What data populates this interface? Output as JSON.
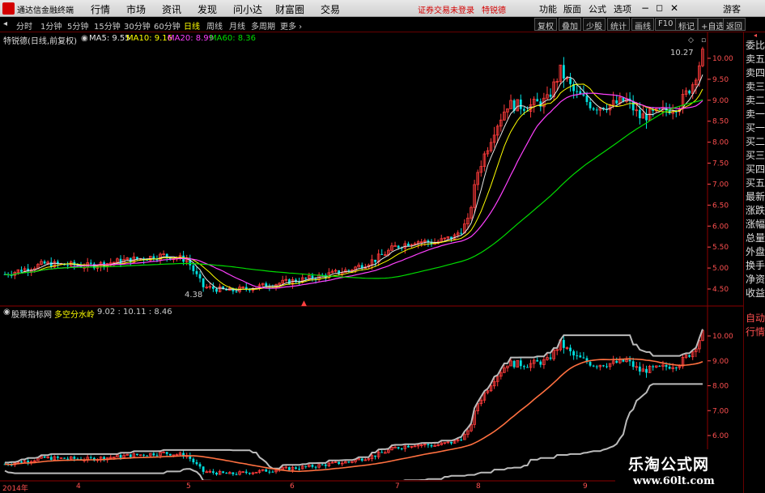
{
  "menubar": {
    "app_name": "通达信金融终端",
    "items": [
      "行情",
      "市场",
      "资讯",
      "发现",
      "问小达",
      "财富圈",
      "交易"
    ],
    "warning": "证券交易未登录",
    "user": "特锐德",
    "right_items": [
      "功能",
      "版面",
      "公式",
      "选项"
    ],
    "help": "游客"
  },
  "tabbar": {
    "periods": [
      "分时",
      "1分钟",
      "5分钟",
      "15分钟",
      "30分钟",
      "60分钟",
      "日线",
      "周线",
      "月线",
      "多周期",
      "更多 ›"
    ],
    "active_index": 6,
    "right_buttons": [
      "复权",
      "叠加",
      "少股",
      "统计",
      "画线",
      "F10",
      "标记",
      "+自选",
      "返回"
    ]
  },
  "main_info": {
    "stock": "特锐德(日线,前复权)",
    "ma5": "MA5: 9.55",
    "ma10": "MA10: 9.16",
    "ma20": "MA20: 8.99",
    "ma60": "MA60: 8.36"
  },
  "sub_info": {
    "site": "股票指标网",
    "indicator": "多空分水岭",
    "values": "9.02 : 10.11 : 8.46"
  },
  "right_panel": {
    "items": [
      "委比",
      "卖五",
      "卖四",
      "卖三",
      "卖二",
      "卖一",
      "买一",
      "买二",
      "买三",
      "买四",
      "买五",
      "最新",
      "涨跌",
      "涨幅",
      "总量",
      "外盘",
      "换手",
      "净资",
      "收益"
    ],
    "bottom_items": [
      "自动",
      "行情"
    ]
  },
  "main_axis": [
    "10.00",
    "9.50",
    "9.00",
    "8.50",
    "8.00",
    "7.50",
    "7.00",
    "6.50",
    "6.00",
    "5.50",
    "5.00",
    "4.50"
  ],
  "main_axis_values": [
    10.0,
    9.5,
    9.0,
    8.5,
    8.0,
    7.5,
    7.0,
    6.5,
    6.0,
    5.5,
    5.0,
    4.5
  ],
  "sub_axis": [
    "10.00",
    "9.00",
    "8.00",
    "7.00",
    "6.00"
  ],
  "sub_axis_values": [
    10.0,
    9.0,
    8.0,
    7.0,
    6.0
  ],
  "annotations": {
    "high": "10.27",
    "low": "4.38"
  },
  "dates": [
    "2014年",
    "4",
    "5",
    "6",
    "7",
    "8",
    "9"
  ],
  "watermark": {
    "title": "乐淘公式网",
    "url": "www.60lt.com"
  },
  "colors": {
    "up": "#ff3b3b",
    "down": "#00e0e0",
    "ma5": "#e6e6e6",
    "ma10": "#ffff00",
    "ma20": "#ff40ff",
    "ma60": "#00dd00"
  }
}
